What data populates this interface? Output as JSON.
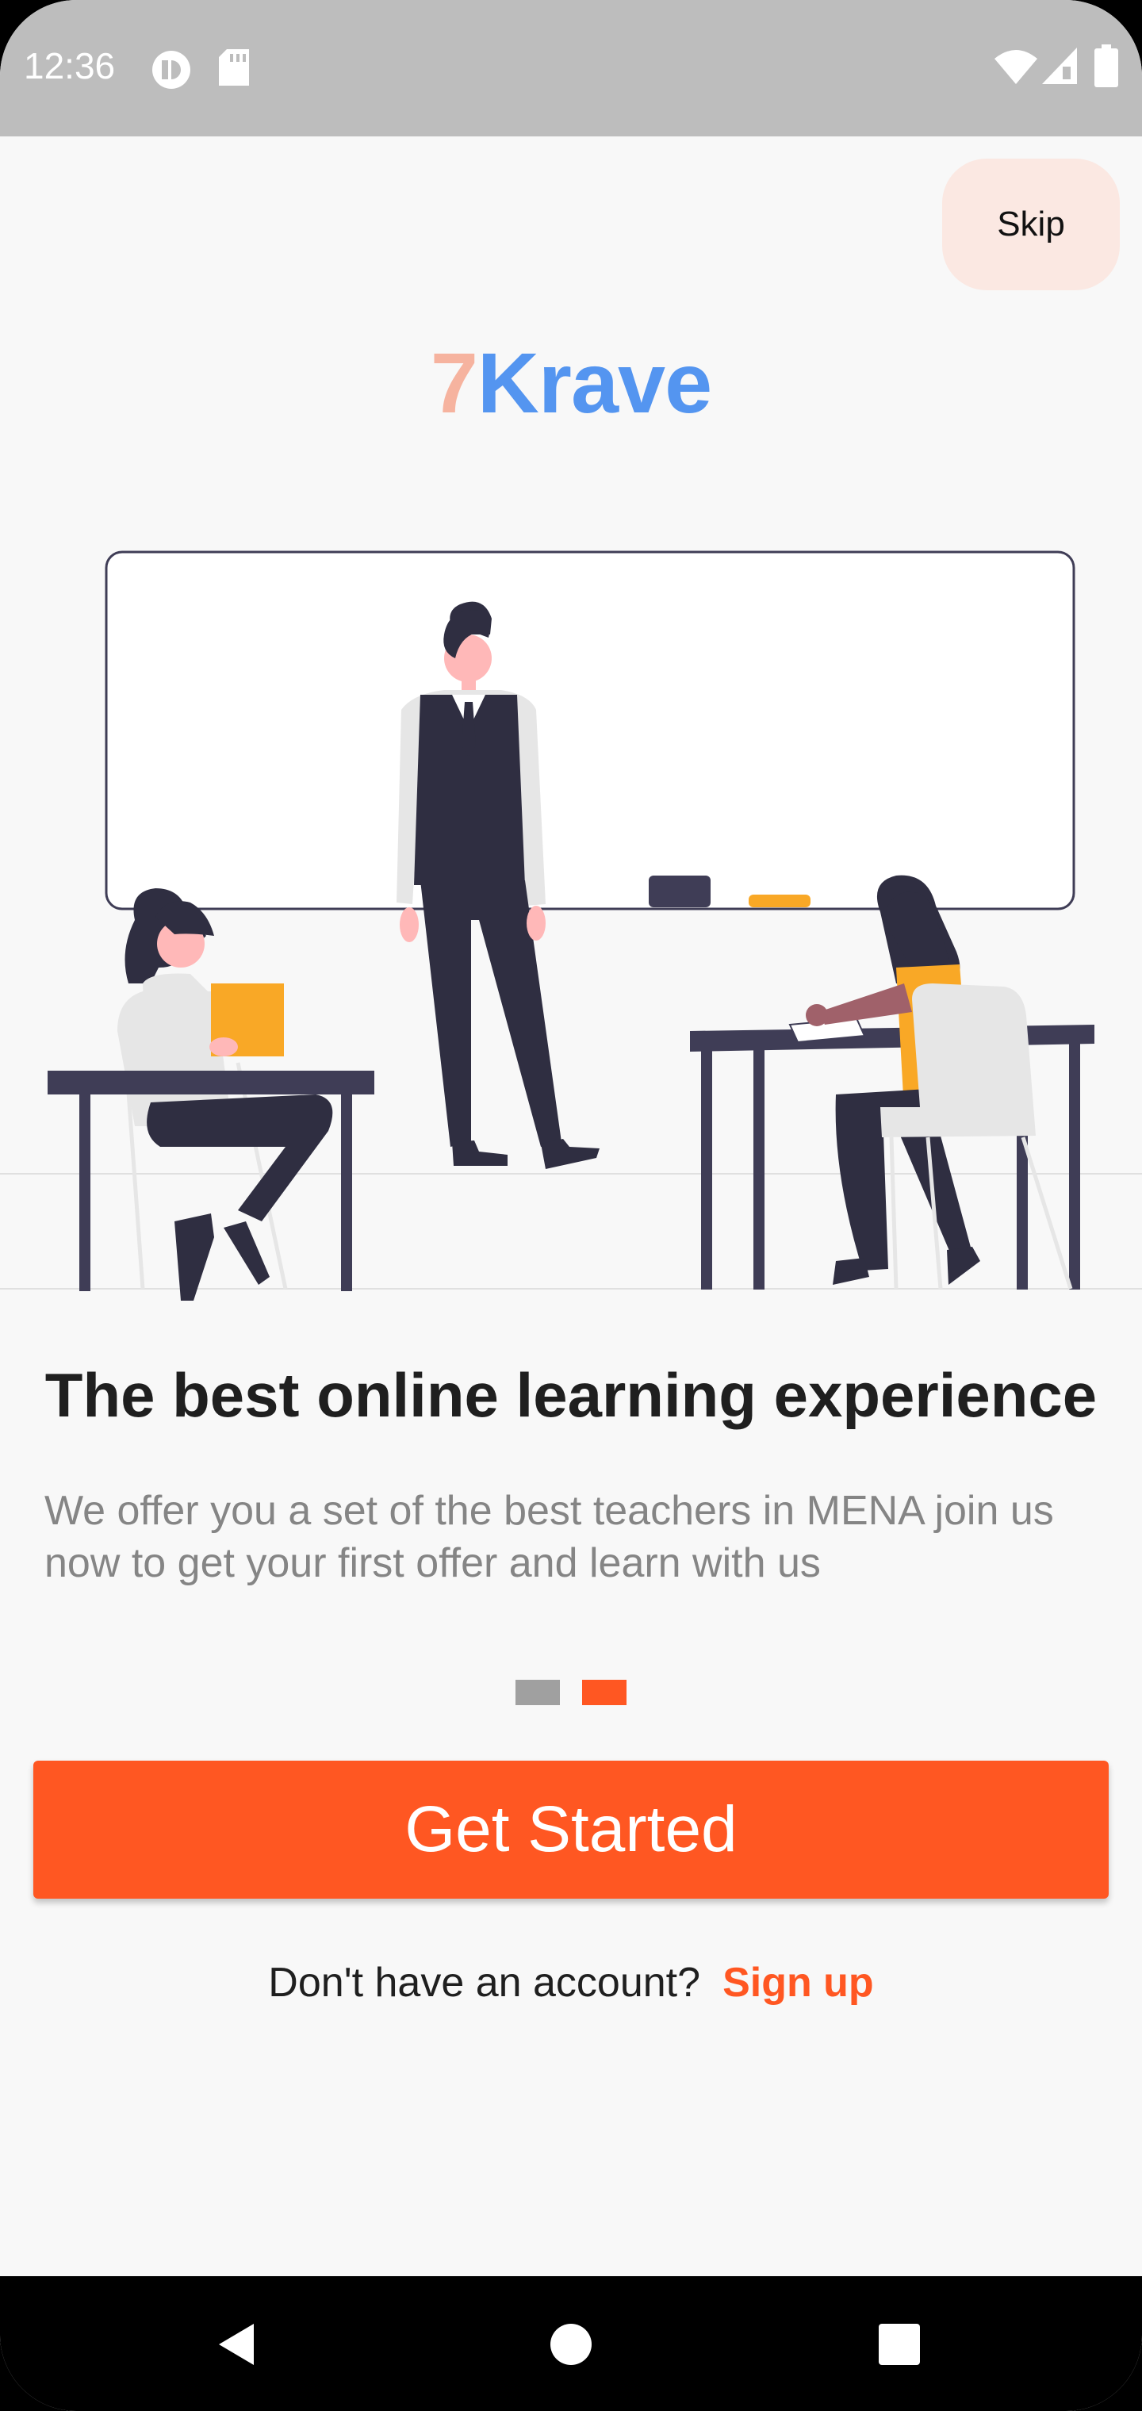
{
  "status_bar": {
    "time": "12:36",
    "icons": [
      "cast-icon",
      "sd-card-icon",
      "wifi-icon",
      "signal-icon",
      "battery-icon"
    ]
  },
  "skip": {
    "label": "Skip"
  },
  "logo": {
    "prefix": "7",
    "name": "Krave"
  },
  "onboarding": {
    "title": "The best online learning experience",
    "description": "We offer you a set of the best teachers in MENA join us now to get your first offer and learn with us",
    "page_count": 2,
    "current_page": 2
  },
  "actions": {
    "get_started": "Get Started",
    "signup_prompt": "Don't have an account?",
    "signup_link": "Sign up"
  },
  "nav_bar": {
    "buttons": [
      "back-icon",
      "home-icon",
      "recents-icon"
    ]
  },
  "colors": {
    "accent": "#ff5722",
    "logo_seven": "#f6b39f",
    "logo_krave": "#5495f0",
    "skip_bg": "#fbe8e2"
  }
}
